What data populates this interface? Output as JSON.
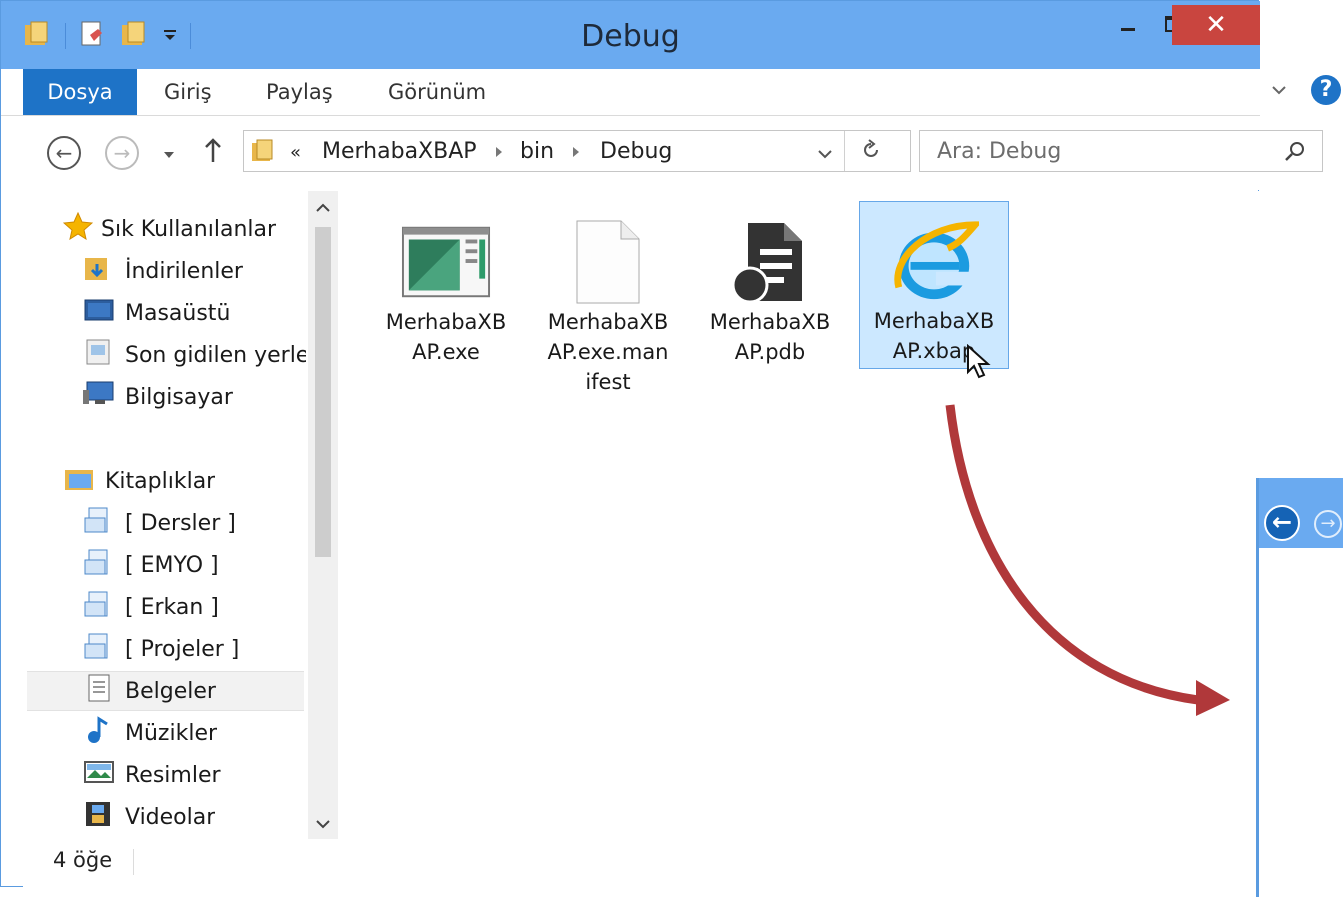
{
  "window": {
    "title": "Debug",
    "close_glyph": "✕"
  },
  "ribbon": {
    "tabs": [
      "Dosya",
      "Giriş",
      "Paylaş",
      "Görünüm"
    ]
  },
  "address": {
    "overflow": "«",
    "path": [
      "MerhabaXBAP",
      "bin",
      "Debug"
    ],
    "search_placeholder": "Ara: Debug"
  },
  "nav": {
    "favorites": {
      "label": "Sık Kullanılanlar",
      "items": [
        "İndirilenler",
        "Masaüstü",
        "Son gidilen yerler",
        "Bilgisayar"
      ]
    },
    "libraries": {
      "label": "Kitaplıklar",
      "items": [
        "[ Dersler ]",
        "[ EMYO ]",
        "[ Erkan ]",
        "[ Projeler ]",
        "Belgeler",
        "Müzikler",
        "Resimler",
        "Videolar"
      ]
    }
  },
  "files": [
    {
      "name_line1": "MerhabaXB",
      "name_line2": "AP.exe",
      "name_line3": "",
      "icon": "exe-window-icon"
    },
    {
      "name_line1": "MerhabaXB",
      "name_line2": "AP.exe.man",
      "name_line3": "ifest",
      "icon": "blank-file-icon"
    },
    {
      "name_line1": "MerhabaXB",
      "name_line2": "AP.pdb",
      "name_line3": "",
      "icon": "pdb-file-icon"
    },
    {
      "name_line1": "MerhabaXB",
      "name_line2": "AP.xbap",
      "name_line3": "",
      "icon": "internet-explorer-icon"
    }
  ],
  "status": {
    "count": "4 öğe"
  },
  "colors": {
    "titlebar": "#6aaaf0",
    "file_tab": "#1e73c7",
    "close": "#c9453f",
    "selection": "#cce8ff",
    "arrow": "#b0383a"
  }
}
